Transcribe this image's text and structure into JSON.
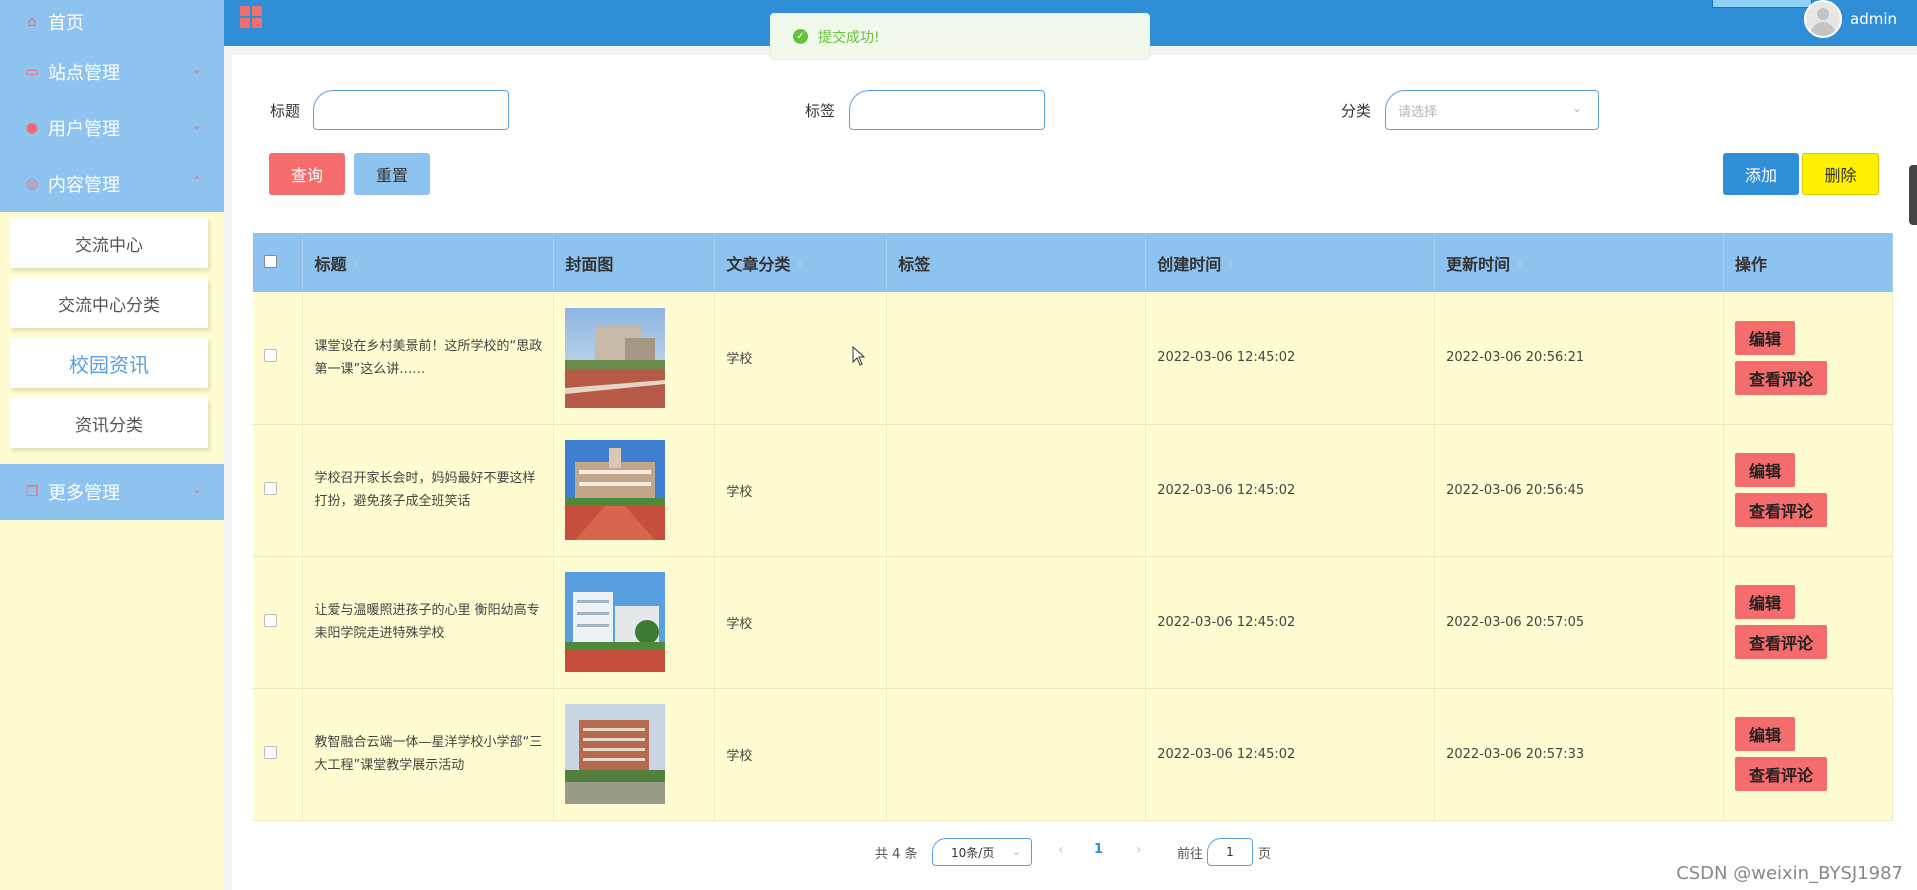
{
  "sidebar": {
    "items": [
      {
        "label": "首页",
        "icon": "home-icon"
      },
      {
        "label": "站点管理",
        "icon": "monitor-icon"
      },
      {
        "label": "用户管理",
        "icon": "user-icon"
      },
      {
        "label": "内容管理",
        "icon": "content-icon"
      },
      {
        "label": "更多管理",
        "icon": "copy-icon"
      }
    ],
    "submenu": [
      "交流中心",
      "交流中心分类",
      "校园资讯",
      "资讯分类"
    ],
    "active_submenu": "校园资讯"
  },
  "header": {
    "username": "admin"
  },
  "toast": {
    "message": "提交成功!",
    "type": "success"
  },
  "filters": {
    "title_label": "标题",
    "tag_label": "标签",
    "category_label": "分类",
    "category_placeholder": "请选择"
  },
  "buttons": {
    "query": "查询",
    "reset": "重置",
    "add": "添加",
    "delete": "删除"
  },
  "table": {
    "columns": [
      "标题",
      "封面图",
      "文章分类",
      "标签",
      "创建时间",
      "更新时间",
      "操作"
    ],
    "rows": [
      {
        "title": "课堂设在乡村美景前！这所学校的“思政第一课”这么讲……",
        "category": "学校",
        "tag": "",
        "created": "2022-03-06 12:45:02",
        "updated": "2022-03-06 20:56:21"
      },
      {
        "title": "学校召开家长会时，妈妈最好不要这样打扮，避免孩子成全班笑话",
        "category": "学校",
        "tag": "",
        "created": "2022-03-06 12:45:02",
        "updated": "2022-03-06 20:56:45"
      },
      {
        "title": "让爱与温暖照进孩子的心里 衡阳幼高专耒阳学院走进特殊学校",
        "category": "学校",
        "tag": "",
        "created": "2022-03-06 12:45:02",
        "updated": "2022-03-06 20:57:05"
      },
      {
        "title": "教智融合云端一体—星洋学校小学部“三大工程”课堂教学展示活动",
        "category": "学校",
        "tag": "",
        "created": "2022-03-06 12:45:02",
        "updated": "2022-03-06 20:57:33"
      }
    ],
    "actions": {
      "edit": "编辑",
      "comments": "查看评论"
    }
  },
  "pagination": {
    "total": "共 4 条",
    "page_size": "10条/页",
    "current_page": "1",
    "goto_label": "前往",
    "goto_value": "1",
    "page_unit": "页"
  },
  "watermark": "CSDN @weixin_BYSJ1987",
  "colors": {
    "primary": "#2f8ed6",
    "menu_bg": "#8ec2ef",
    "sidebar_bg": "#fefcd0",
    "danger": "#f56c6c",
    "warning": "#fff200",
    "success": "#67c23a"
  }
}
